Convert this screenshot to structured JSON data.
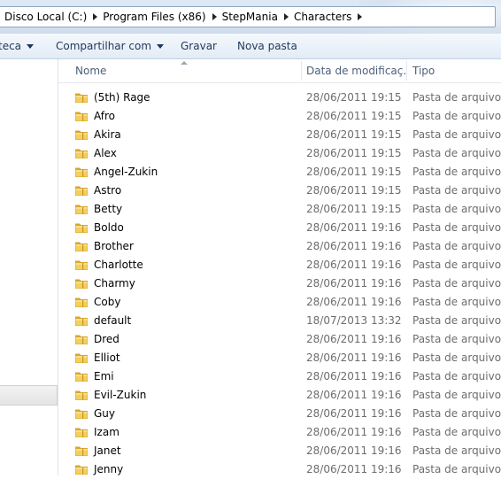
{
  "breadcrumb": [
    {
      "label": "Disco Local (C:)"
    },
    {
      "label": "Program Files (x86)"
    },
    {
      "label": "StepMania"
    },
    {
      "label": "Characters"
    }
  ],
  "toolbar": {
    "library_label": "teca",
    "share_label": "Compartilhar com",
    "burn_label": "Gravar",
    "new_folder_label": "Nova pasta"
  },
  "columns": {
    "name": "Nome",
    "date": "Data de modificaç...",
    "type": "Tipo"
  },
  "icons": {
    "folder": "folder-icon",
    "chevron": "chevron-right-icon"
  },
  "colors": {
    "folder": "#e8b73a",
    "header_text": "#4c607a",
    "meta_text": "#6d6d6d"
  },
  "files": [
    {
      "name": "(5th) Rage",
      "date": "28/06/2011 19:15",
      "type": "Pasta de arquivos"
    },
    {
      "name": "Afro",
      "date": "28/06/2011 19:15",
      "type": "Pasta de arquivos"
    },
    {
      "name": "Akira",
      "date": "28/06/2011 19:15",
      "type": "Pasta de arquivos"
    },
    {
      "name": "Alex",
      "date": "28/06/2011 19:15",
      "type": "Pasta de arquivos"
    },
    {
      "name": "Angel-Zukin",
      "date": "28/06/2011 19:15",
      "type": "Pasta de arquivos"
    },
    {
      "name": "Astro",
      "date": "28/06/2011 19:15",
      "type": "Pasta de arquivos"
    },
    {
      "name": "Betty",
      "date": "28/06/2011 19:15",
      "type": "Pasta de arquivos"
    },
    {
      "name": "Boldo",
      "date": "28/06/2011 19:16",
      "type": "Pasta de arquivos"
    },
    {
      "name": "Brother",
      "date": "28/06/2011 19:16",
      "type": "Pasta de arquivos"
    },
    {
      "name": "Charlotte",
      "date": "28/06/2011 19:16",
      "type": "Pasta de arquivos"
    },
    {
      "name": "Charmy",
      "date": "28/06/2011 19:16",
      "type": "Pasta de arquivos"
    },
    {
      "name": "Coby",
      "date": "28/06/2011 19:16",
      "type": "Pasta de arquivos"
    },
    {
      "name": "default",
      "date": "18/07/2013 13:32",
      "type": "Pasta de arquivos"
    },
    {
      "name": "Dred",
      "date": "28/06/2011 19:16",
      "type": "Pasta de arquivos"
    },
    {
      "name": "Elliot",
      "date": "28/06/2011 19:16",
      "type": "Pasta de arquivos"
    },
    {
      "name": "Emi",
      "date": "28/06/2011 19:16",
      "type": "Pasta de arquivos"
    },
    {
      "name": "Evil-Zukin",
      "date": "28/06/2011 19:16",
      "type": "Pasta de arquivos"
    },
    {
      "name": "Guy",
      "date": "28/06/2011 19:16",
      "type": "Pasta de arquivos"
    },
    {
      "name": "Izam",
      "date": "28/06/2011 19:16",
      "type": "Pasta de arquivos"
    },
    {
      "name": "Janet",
      "date": "28/06/2011 19:16",
      "type": "Pasta de arquivos"
    },
    {
      "name": "Jenny",
      "date": "28/06/2011 19:16",
      "type": "Pasta de arquivos"
    }
  ]
}
